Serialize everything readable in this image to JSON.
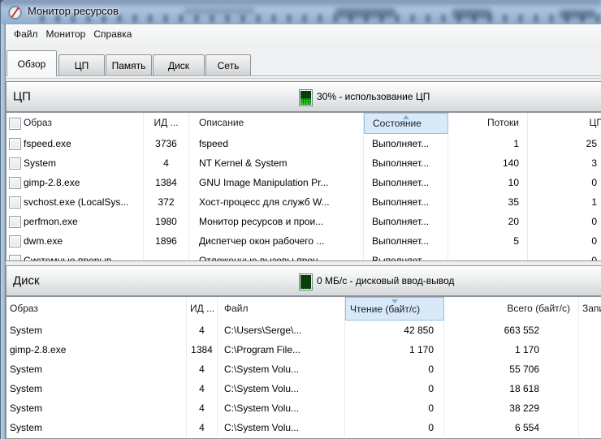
{
  "window": {
    "title": "Монитор ресурсов"
  },
  "menubar": {
    "items": [
      "Файл",
      "Монитор",
      "Справка"
    ]
  },
  "tabs": [
    {
      "label": "Обзор",
      "active": true
    },
    {
      "label": "ЦП",
      "active": false
    },
    {
      "label": "Память",
      "active": false
    },
    {
      "label": "Диск",
      "active": false
    },
    {
      "label": "Сеть",
      "active": false
    }
  ],
  "cpu": {
    "title": "ЦП",
    "status": "30% - использование ЦП",
    "led_percent": 45,
    "columns": [
      {
        "label": ""
      },
      {
        "label": "Образ"
      },
      {
        "label": "ИД ..."
      },
      {
        "label": "Описание"
      },
      {
        "label": "Состояние",
        "sorted": "asc"
      },
      {
        "label": "Потоки"
      },
      {
        "label": "ЦП"
      }
    ],
    "rows": [
      [
        "fspeed.exe",
        "3736",
        "fspeed",
        "Выполняет...",
        "1",
        "25"
      ],
      [
        "System",
        "4",
        "NT Kernel & System",
        "Выполняет...",
        "140",
        "3"
      ],
      [
        "gimp-2.8.exe",
        "1384",
        "GNU Image Manipulation Pr...",
        "Выполняет...",
        "10",
        "0"
      ],
      [
        "svchost.exe (LocalSys...",
        "372",
        "Хост-процесс для служб W...",
        "Выполняет...",
        "35",
        "1"
      ],
      [
        "perfmon.exe",
        "1980",
        "Монитор ресурсов и прои...",
        "Выполняет...",
        "20",
        "0"
      ],
      [
        "dwm.exe",
        "1896",
        "Диспетчер окон рабочего ...",
        "Выполняет...",
        "5",
        "0"
      ],
      [
        "Системные прерыв...",
        "-",
        "Отложенные вызовы проц...",
        "Выполняет...",
        "-",
        "0"
      ]
    ]
  },
  "disk": {
    "title": "Диск",
    "status": "0 МБ/с - дисковый ввод-вывод",
    "led_percent": 8,
    "columns": [
      {
        "label": "Образ"
      },
      {
        "label": "ИД ..."
      },
      {
        "label": "Файл"
      },
      {
        "label": "Чтение (байт/с)",
        "sorted": "desc"
      },
      {
        "label": "Всего (байт/с)"
      },
      {
        "label": "Запись (байт/с)"
      }
    ],
    "rows": [
      [
        "System",
        "4",
        "C:\\Users\\Serge\\...",
        "42 850",
        "663 552"
      ],
      [
        "gimp-2.8.exe",
        "1384",
        "C:\\Program File...",
        "1 170",
        "1 170"
      ],
      [
        "System",
        "4",
        "C:\\System Volu...",
        "0",
        "55 706"
      ],
      [
        "System",
        "4",
        "C:\\System Volu...",
        "0",
        "18 618"
      ],
      [
        "System",
        "4",
        "C:\\System Volu...",
        "0",
        "38 229"
      ],
      [
        "System",
        "4",
        "C:\\System Volu...",
        "0",
        "6 554"
      ]
    ]
  },
  "colors": {
    "titlebar_glass": "#a9c2dc",
    "led_bright_green": "#2bd42b",
    "led_dark_green": "#0d470f",
    "sorted_column_highlight": "#d8eafa"
  }
}
